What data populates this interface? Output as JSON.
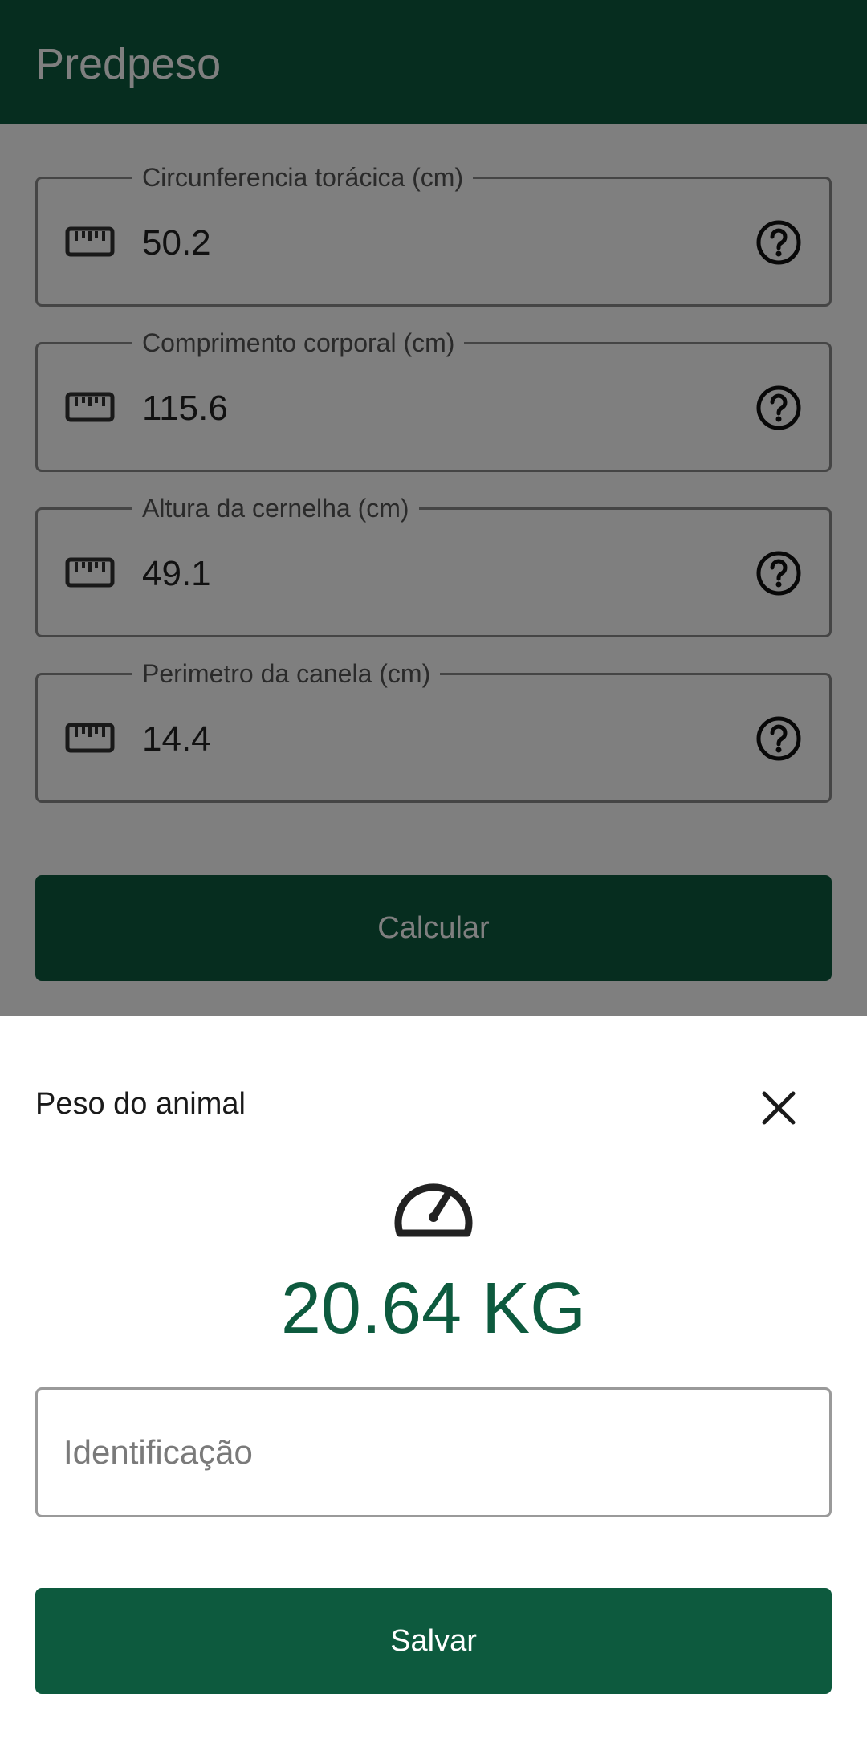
{
  "app": {
    "title": "Predpeso"
  },
  "fields": [
    {
      "label": "Circunferencia torácica (cm)",
      "value": "50.2",
      "icon": "ruler-icon",
      "help_icon": "help-icon"
    },
    {
      "label": "Comprimento corporal (cm)",
      "value": "115.6",
      "icon": "ruler-icon",
      "help_icon": "help-icon"
    },
    {
      "label": "Altura da cernelha (cm)",
      "value": "49.1",
      "icon": "ruler-icon",
      "help_icon": "help-icon"
    },
    {
      "label": "Perimetro da canela (cm)",
      "value": "14.4",
      "icon": "ruler-icon",
      "help_icon": "help-icon"
    }
  ],
  "calculate_label": "Calcular",
  "sheet": {
    "title": "Peso do animal",
    "close_icon": "close-icon",
    "gauge_icon": "speedometer-icon",
    "weight": "20.64 KG",
    "identification_placeholder": "Identificação",
    "identification_value": "",
    "save_label": "Salvar"
  },
  "colors": {
    "primary": "#0d5a3e",
    "scrim": "rgba(0,0,0,0.5)",
    "surface": "#ffffff"
  }
}
